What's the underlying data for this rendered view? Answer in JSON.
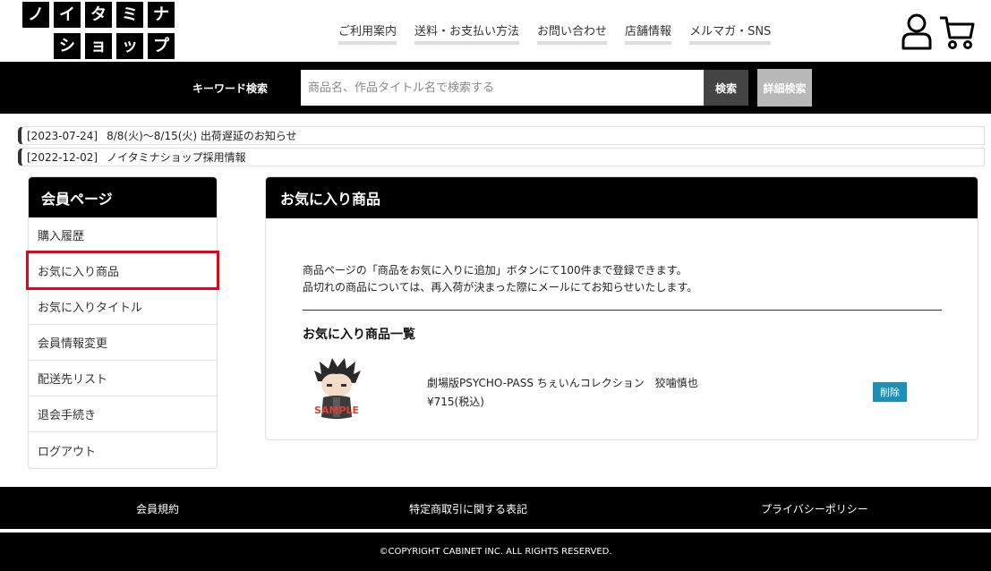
{
  "header": {
    "logo_tiles": [
      "ノ",
      "イ",
      "タ",
      "ミ",
      "ナ",
      "シ",
      "ョ",
      "ッ",
      "プ"
    ],
    "nav": [
      "ご利用案内",
      "送料・お支払い方法",
      "お問い合わせ",
      "店舗情報",
      "メルマガ・SNS"
    ],
    "icons": {
      "account": "user-icon",
      "cart": "cart-icon"
    }
  },
  "search": {
    "label": "キーワード検索",
    "placeholder": "商品名、作品タイトル名で検索する",
    "button": "検索",
    "detail_button": "詳細検索"
  },
  "notices": [
    {
      "date": "[2023-07-24]",
      "text": "8/8(火)～8/15(火) 出荷遅延のお知らせ"
    },
    {
      "date": "[2022-12-02]",
      "text": "ノイタミナショップ採用情報"
    }
  ],
  "sidebar": {
    "title": "会員ページ",
    "items": [
      {
        "label": "購入履歴"
      },
      {
        "label": "お気に入り商品"
      },
      {
        "label": "お気に入りタイトル"
      },
      {
        "label": "会員情報変更"
      },
      {
        "label": "配送先リスト"
      },
      {
        "label": "退会手続き"
      },
      {
        "label": "ログアウト"
      }
    ],
    "highlight_color": "#e8001c"
  },
  "main": {
    "title": "お気に入り商品",
    "description_line1": "商品ページの「商品をお気に入りに追加」ボタンにて100件まで登録できます。",
    "description_line2": "品切れの商品については、再入荷が決まった際にメールにてお知らせいたします。",
    "list_title": "お気に入り商品一覧",
    "items": [
      {
        "name": "劇場版PSYCHO-PASS ちぇいんコレクション　狡噛慎也",
        "price": "¥715(税込)",
        "delete_label": "削除",
        "image_watermark": "SAMPLE"
      }
    ]
  },
  "footer": {
    "links": [
      "会員規約",
      "特定商取引に関する表記",
      "プライバシーポリシー"
    ],
    "copyright": "©COPYRIGHT CABINET INC. ALL RIGHTS RESERVED."
  },
  "colors": {
    "primary": "#000000",
    "delete_button": "#1a8fb7",
    "detail_button": "#b8b8b8"
  }
}
